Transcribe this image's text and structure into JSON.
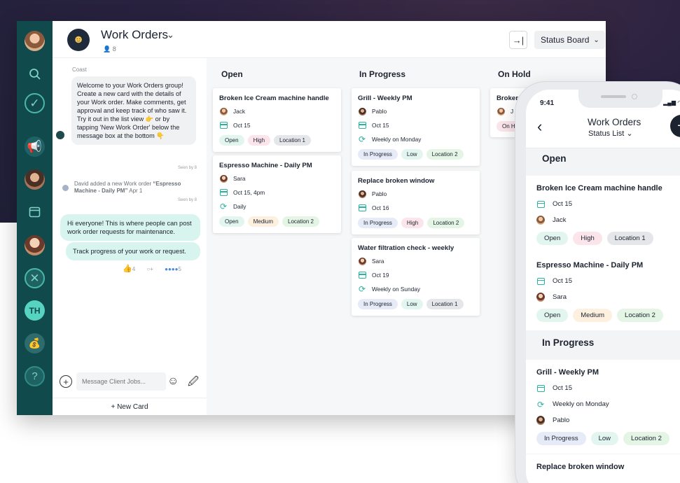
{
  "app": {
    "title": "Work Orders",
    "members": "8",
    "view_select": "Status Board",
    "add_label": "+"
  },
  "rail": {
    "icons": [
      "search-icon",
      "check-icon",
      "megaphone-icon",
      "calendar-icon",
      "tools-icon",
      "help-icon"
    ],
    "th_initials": "TH"
  },
  "chat": {
    "sender": "Coast",
    "welcome": "Welcome to your Work Orders group! Create a new card with the details of your Work order. Make comments, get approval and keep track of who saw it. Try it out in the list view 👉 or by tapping 'New Work Order' below the message box at the bottom 👇",
    "seen_1": "Seen by 8",
    "event_prefix": "David added a new Work order ",
    "event_item": "“Espresso Machine - Daily PM”",
    "event_date": " Apr 1",
    "seen_2": "Seen by 8",
    "msg_1": "Hi everyone! This is where people can post work order requests for maintenance.",
    "msg_2": "Track progress of your work or request.",
    "reaction_count": "4",
    "seen_count": "5",
    "composer_placeholder": "Message Client Jobs...",
    "new_card": "+ New Card"
  },
  "board": {
    "columns": [
      {
        "title": "Open",
        "cards": [
          {
            "title": "Broken Ice Cream machine handle",
            "person": "Jack",
            "date": "Oct 15",
            "tags": [
              "Open",
              "High",
              "Location 1"
            ]
          },
          {
            "title": "Espresso Machine - Daily PM",
            "person": "Sara",
            "date": "Oct 15, 4pm",
            "repeat": "Daily",
            "tags": [
              "Open",
              "Medium",
              "Location 2"
            ]
          }
        ]
      },
      {
        "title": "In Progress",
        "cards": [
          {
            "title": "Grill - Weekly PM",
            "person": "Pablo",
            "date": "Oct 15",
            "repeat": "Weekly on Monday",
            "tags": [
              "In Progress",
              "Low",
              "Location 2"
            ]
          },
          {
            "title": "Replace broken window",
            "person": "Pablo",
            "date": "Oct 16",
            "tags": [
              "In Progress",
              "High",
              "Location 2"
            ]
          },
          {
            "title": "Water filtration check - weekly",
            "person": "Sara",
            "date": "Oct 19",
            "repeat": "Weekly on Sunday",
            "tags": [
              "In Progress",
              "Low",
              "Location 1"
            ]
          }
        ]
      },
      {
        "title": "On Hold",
        "cards": [
          {
            "title": "Broker",
            "person": "J",
            "tags": [
              "On H"
            ]
          }
        ]
      }
    ]
  },
  "phone": {
    "time": "9:41",
    "title": "Work Orders",
    "subtitle": "Status List",
    "sections": [
      {
        "title": "Open",
        "cards": [
          {
            "title": "Broken Ice Cream machine handle",
            "date": "Oct 15",
            "person": "Jack",
            "tags": [
              "Open",
              "High",
              "Location 1"
            ]
          },
          {
            "title": "Espresso Machine - Daily PM",
            "date": "Oct 15",
            "person": "Sara",
            "tags": [
              "Open",
              "Medium",
              "Location 2"
            ]
          }
        ]
      },
      {
        "title": "In Progress",
        "cards": [
          {
            "title": "Grill - Weekly PM",
            "date": "Oct 15",
            "repeat": "Weekly on Monday",
            "person": "Pablo",
            "tags": [
              "In Progress",
              "Low",
              "Location 2"
            ]
          },
          {
            "title": "Replace broken window"
          }
        ]
      }
    ]
  },
  "colors": {
    "rail": "#104a4c",
    "accent": "#2bb3a0",
    "dark": "#1c2330"
  }
}
